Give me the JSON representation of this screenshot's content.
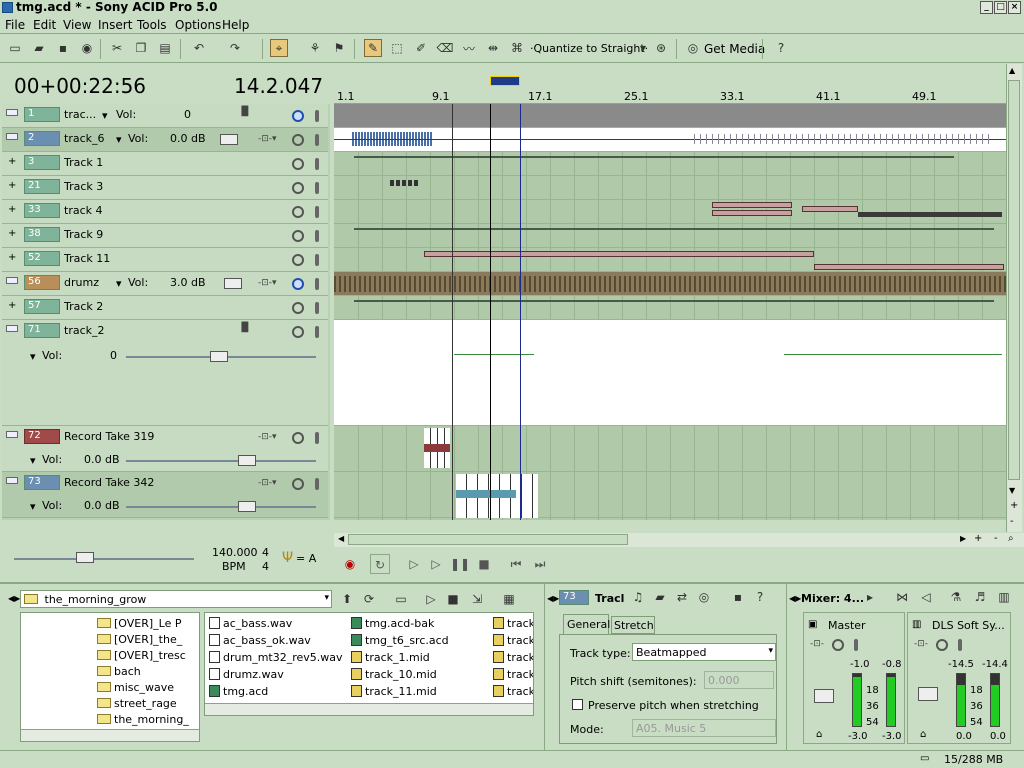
{
  "window": {
    "title": "tmg.acd * - Sony ACID Pro 5.0",
    "min": "_",
    "max": "□",
    "close": "×"
  },
  "menu": [
    "File",
    "Edit",
    "View",
    "Insert",
    "Tools",
    "Options",
    "Help"
  ],
  "toolbar": {
    "quantize": "·Quantize to Straight·",
    "get_media": "Get Media"
  },
  "time": {
    "timecode": "00+00:22:56",
    "beat": "14.2.047"
  },
  "ruler": {
    "labels": [
      "1.1",
      "9.1",
      "17.1",
      "25.1",
      "33.1",
      "41.1",
      "49.1"
    ]
  },
  "tracks": [
    {
      "num": "1",
      "name": "trac...",
      "vol_label": "Vol:",
      "vol": "0"
    },
    {
      "num": "2",
      "name": "track_6",
      "vol_label": "Vol:",
      "vol": "0.0 dB"
    },
    {
      "num": "3",
      "name": "Track 1"
    },
    {
      "num": "21",
      "name": "Track 3"
    },
    {
      "num": "33",
      "name": "track 4"
    },
    {
      "num": "38",
      "name": "Track 9"
    },
    {
      "num": "52",
      "name": "Track 11"
    },
    {
      "num": "56",
      "name": "drumz",
      "vol_label": "Vol:",
      "vol": "3.0 dB"
    },
    {
      "num": "57",
      "name": "Track 2"
    },
    {
      "num": "71",
      "name": "track_2",
      "vol_label": "Vol:",
      "vol": "0"
    },
    {
      "num": "72",
      "name": "Record Take 319",
      "vol_label": "Vol:",
      "vol": "0.0 dB"
    },
    {
      "num": "73",
      "name": "Record Take 342",
      "vol_label": "Vol:",
      "vol": "0.0 dB"
    }
  ],
  "tempo": {
    "bpm": "140.000",
    "bpm_label": "BPM",
    "sig_top": "4",
    "sig_bottom": "4",
    "key": "= A"
  },
  "explorer": {
    "path": "the_morning_grow",
    "folders": [
      "[OVER]_Le P",
      "[OVER]_the_",
      "[OVER]_tresc",
      "bach",
      "misc_wave",
      "street_rage",
      "the_morning_"
    ],
    "files_col1": [
      "ac_bass.wav",
      "ac_bass_ok.wav",
      "drum_mt32_rev5.wav",
      "drumz.wav",
      "tmg.acd"
    ],
    "files_col2": [
      "tmg.acd-bak",
      "tmg_t6_src.acd",
      "track_1.mid",
      "track_10.mid",
      "track_11.mid"
    ],
    "files_col3": [
      "track",
      "track",
      "track",
      "track",
      "track"
    ]
  },
  "track_props": {
    "num": "73",
    "title": "Tracl",
    "tabs": [
      "General",
      "Stretch"
    ],
    "track_type_label": "Track type:",
    "track_type": "Beatmapped",
    "pitch_label": "Pitch shift (semitones):",
    "pitch_value": "0.000",
    "preserve_label": "Preserve pitch when stretching",
    "mode_label": "Mode:",
    "mode_value": "A05. Music 5"
  },
  "mixer": {
    "title": "Mixer: 4...",
    "master": {
      "name": "Master",
      "peak_l": "-1.0",
      "peak_r": "-0.8",
      "scale": [
        "18",
        "36",
        "54"
      ],
      "level_l": "-3.0",
      "level_r": "-3.0"
    },
    "dls": {
      "name": "DLS Soft Sy...",
      "peak_l": "-14.5",
      "peak_r": "-14.4",
      "scale": [
        "18",
        "36",
        "54"
      ],
      "level_l": "0.0",
      "level_r": "0.0"
    }
  },
  "status": {
    "memory": "15/288 MB"
  }
}
